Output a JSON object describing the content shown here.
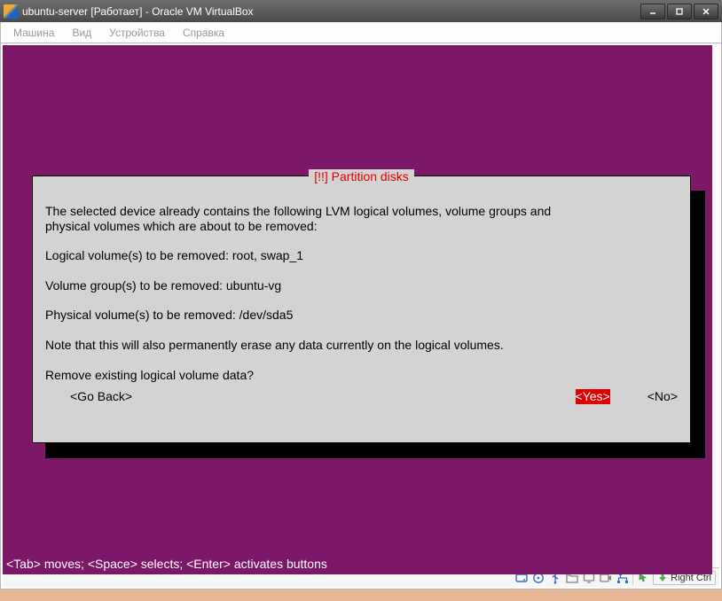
{
  "window": {
    "title": "ubuntu-server [Работает] - Oracle VM VirtualBox"
  },
  "menu": {
    "items": [
      "Машина",
      "Вид",
      "Устройства",
      "Справка"
    ]
  },
  "dialog": {
    "header": "[!!] Partition disks",
    "line1": "The selected device already contains the following LVM logical volumes, volume groups and",
    "line2": "physical volumes which are about to be removed:",
    "lv_line": "Logical volume(s) to be removed: root, swap_1",
    "vg_line": "Volume group(s) to be removed: ubuntu-vg",
    "pv_line": "Physical volume(s) to be removed: /dev/sda5",
    "note": "Note that this will also permanently erase any data currently on the logical volumes.",
    "prompt": "Remove existing logical volume data?",
    "go_back": "<Go Back>",
    "yes": "<Yes>",
    "no": "<No>"
  },
  "footer_hint": "<Tab> moves; <Space> selects; <Enter> activates buttons",
  "status": {
    "host_key": "Right Ctrl"
  }
}
